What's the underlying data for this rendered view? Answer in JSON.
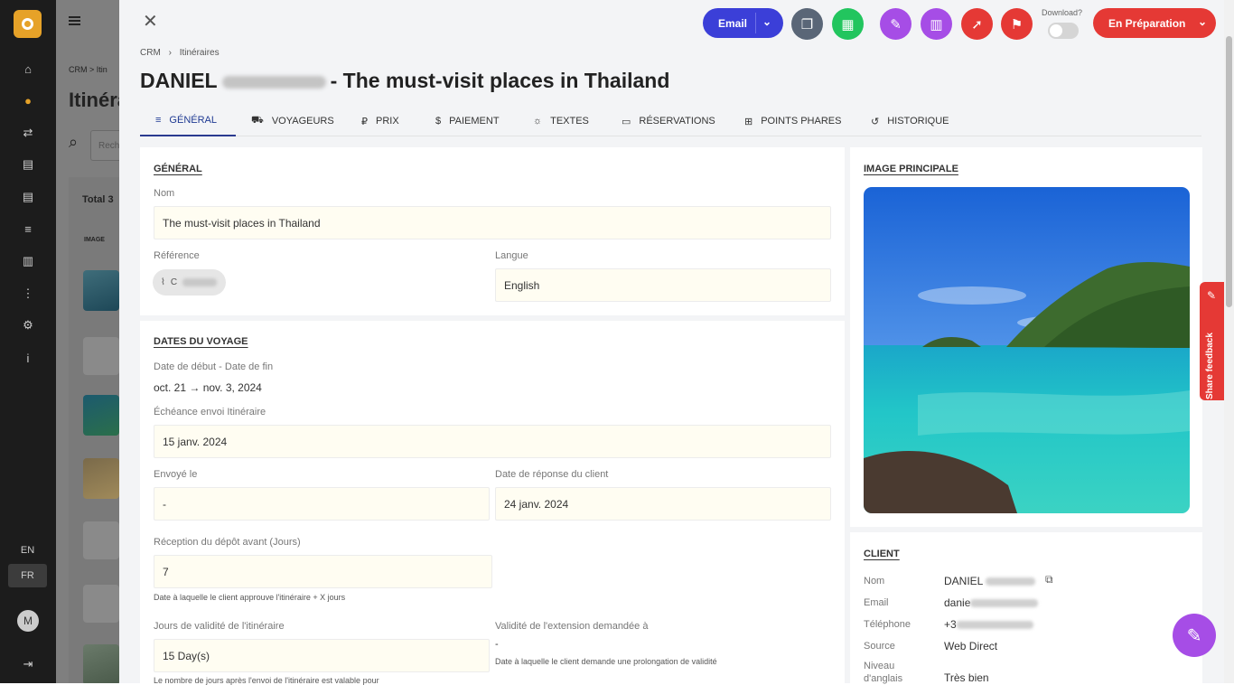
{
  "rail": {
    "lang_en": "EN",
    "lang_fr": "FR",
    "avatar_initial": "M"
  },
  "background_page": {
    "breadcrumb": "CRM > Itin",
    "title": "Itinéra",
    "search_placeholder": "Rech",
    "total": "Total 3",
    "col_image": "IMAGE"
  },
  "header": {
    "email_button": "Email",
    "download_label": "Download?",
    "status": "En Préparation",
    "breadcrumb": [
      "CRM",
      "Itinéraires"
    ],
    "title_first": "DANIEL",
    "title_rest": "- The must-visit places in Thailand"
  },
  "tabs": [
    {
      "label": "GÉNÉRAL",
      "icon": "list-icon"
    },
    {
      "label": "VOYAGEURS",
      "icon": "car-icon"
    },
    {
      "label": "PRIX",
      "icon": "ruble-icon"
    },
    {
      "label": "PAIEMENT",
      "icon": "dollar-icon"
    },
    {
      "label": "TEXTES",
      "icon": "sun-icon"
    },
    {
      "label": "RÉSERVATIONS",
      "icon": "ticket-icon"
    },
    {
      "label": "POINTS PHARES",
      "icon": "grid-icon"
    },
    {
      "label": "HISTORIQUE",
      "icon": "history-icon"
    }
  ],
  "general": {
    "heading": "GÉNÉRAL",
    "nom_label": "Nom",
    "nom_value": "The must-visit places in Thailand",
    "reference_label": "Référence",
    "reference_prefix": "C",
    "langue_label": "Langue",
    "langue_value": "English"
  },
  "dates": {
    "heading": "DATES DU VOYAGE",
    "range_label": "Date de début - Date de fin",
    "range_value": "oct. 21 → nov. 3, 2024",
    "echeance_label": "Échéance envoi Itinéraire",
    "echeance_value": "15 janv. 2024",
    "envoye_label": "Envoyé le",
    "envoye_value": "-",
    "reponse_label": "Date de réponse du client",
    "reponse_value": "24 janv. 2024",
    "depot_label": "Réception du dépôt avant (Jours)",
    "depot_value": "7",
    "depot_hint": "Date à laquelle le client approuve l'itinéraire + X jours",
    "validite_label": "Jours de validité de l'itinéraire",
    "validite_value": "15 Day(s)",
    "validite_hint": "Le nombre de jours après l'envoi de l'itinéraire est valable pour",
    "extension_label": "Validité de l'extension demandée à",
    "extension_value": "-",
    "extension_hint": "Date à laquelle le client demande une prolongation de validité"
  },
  "image": {
    "heading": "IMAGE PRINCIPALE"
  },
  "client": {
    "heading": "CLIENT",
    "nom_label": "Nom",
    "nom_value": "DANIEL",
    "email_label": "Email",
    "email_value": "danie",
    "phone_label": "Téléphone",
    "phone_value": "+3",
    "source_label": "Source",
    "source_value": "Web Direct",
    "niveau_label_1": "Niveau",
    "niveau_label_2": "d'anglais",
    "niveau_value": "Très bien"
  },
  "feedback": "Share feedback",
  "colors": {
    "accent": "#3b3fd8",
    "status": "#e53935",
    "purple": "#a64de6",
    "green": "#22c55e",
    "gray": "#5a6677"
  }
}
